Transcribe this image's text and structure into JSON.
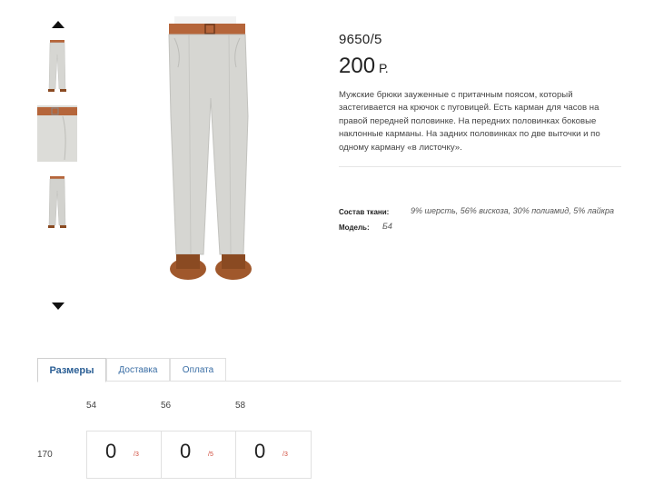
{
  "product": {
    "sku": "9650/5",
    "price": "200",
    "currency": "Р.",
    "description": "Мужские брюки зауженные с притачным поясом, который застегивается на крючок с пуговицей. Есть карман для часов на правой передней половинке. На передних половинках боковые наклонные карманы. На задних половинках по две выточки и по одному карману «в листочку».",
    "attributes": [
      {
        "label": "Состав ткани:",
        "value": "9% шерсть, 56% вискоза, 30% полиамид, 5% лайкра"
      },
      {
        "label": "Модель:",
        "value": "Б4"
      }
    ]
  },
  "gallery": {
    "thumbnails": [
      "trousers-front-thumb",
      "trousers-waist-thumb",
      "trousers-back-thumb"
    ],
    "colors": {
      "fabric": "#d6d6d2",
      "belt": "#b5653a",
      "shoe": "#8a4a22"
    }
  },
  "tabs": [
    {
      "label": "Размеры",
      "active": true
    },
    {
      "label": "Доставка",
      "active": false
    },
    {
      "label": "Оплата",
      "active": false
    }
  ],
  "sizes": {
    "headers": [
      "54",
      "56",
      "58"
    ],
    "rows": [
      {
        "height": "170",
        "cells": [
          {
            "qty": "0",
            "stock": "/3"
          },
          {
            "qty": "0",
            "stock": "/5"
          },
          {
            "qty": "0",
            "stock": "/3"
          }
        ]
      }
    ]
  },
  "accent_color": "#2b5f95",
  "stock_color": "#d04a3a"
}
